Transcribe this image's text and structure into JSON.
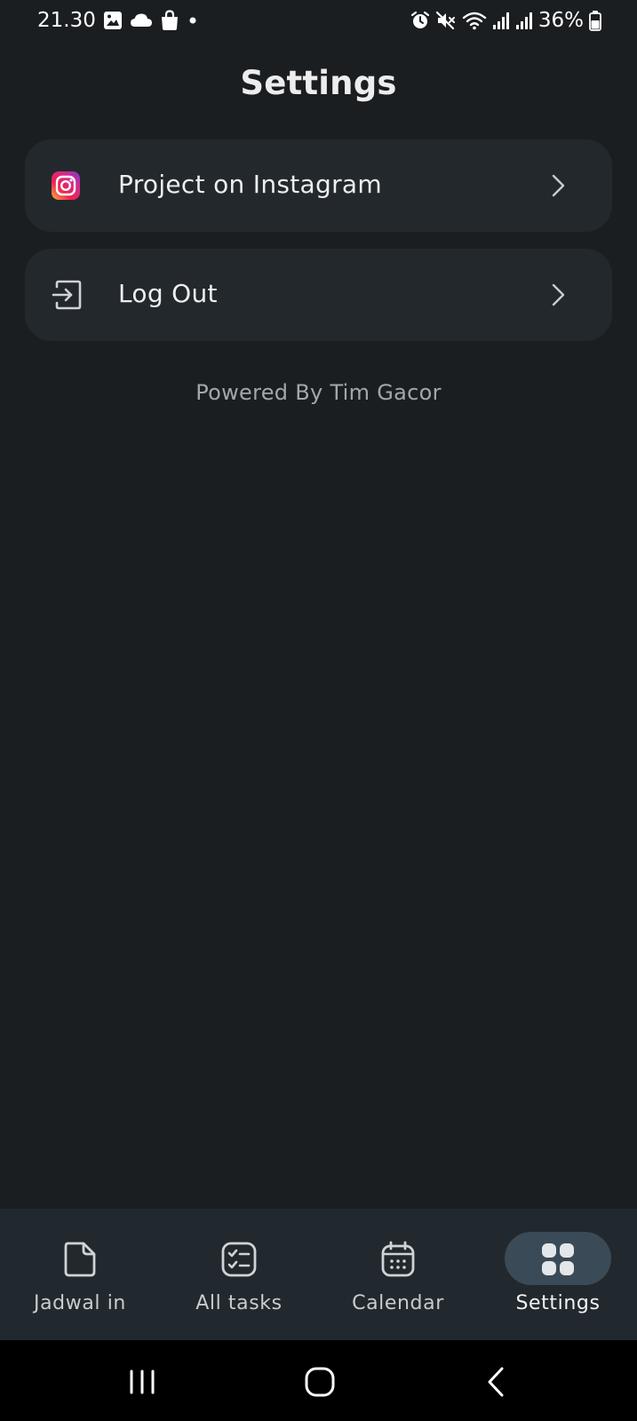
{
  "status_bar": {
    "time": "21.30",
    "battery": "36%"
  },
  "page": {
    "title": "Settings"
  },
  "settings": {
    "items": [
      {
        "label": "Project on Instagram",
        "icon": "instagram-icon"
      },
      {
        "label": "Log Out",
        "icon": "logout-icon"
      }
    ],
    "footer": "Powered By Tim Gacor"
  },
  "bottom_nav": {
    "items": [
      {
        "label": "Jadwal in",
        "icon": "folder-icon"
      },
      {
        "label": "All tasks",
        "icon": "checklist-icon"
      },
      {
        "label": "Calendar",
        "icon": "calendar-icon"
      },
      {
        "label": "Settings",
        "icon": "grid-icon"
      }
    ],
    "active_index": 3
  },
  "colors": {
    "background": "#1b1e21",
    "card": "#23282d",
    "nav_bar": "#22292e",
    "active_pill": "#3a4a56"
  }
}
